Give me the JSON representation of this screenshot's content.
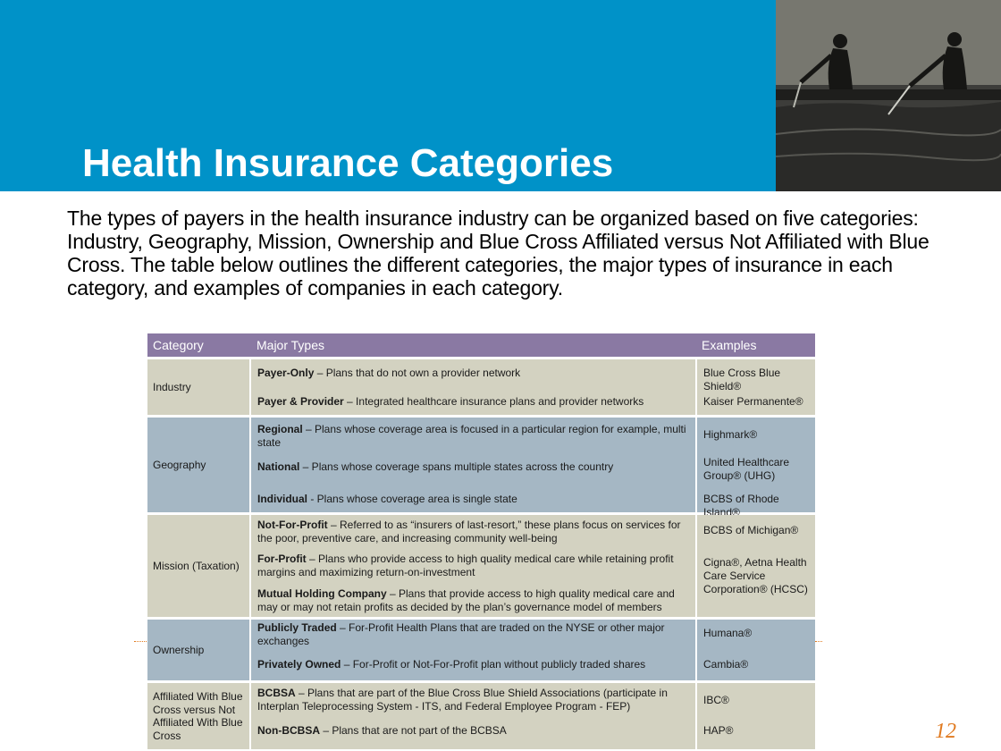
{
  "title": "Health Insurance Categories",
  "intro": "The types of payers in the health insurance industry can be organized based on five categories: Industry, Geography, Mission, Ownership and Blue Cross Affiliated versus Not Affiliated with Blue Cross. The table below outlines the different categories, the major types of insurance in each category, and examples of companies in each category.",
  "table": {
    "headers": [
      "Category",
      "Major Types",
      "Examples"
    ],
    "groups": [
      {
        "category": "Industry",
        "types": [
          {
            "label": "Payer-Only",
            "desc": " – Plans that do not own a provider network"
          },
          {
            "label": "Payer & Provider",
            "desc": " – Integrated healthcare insurance plans and provider networks"
          }
        ],
        "examples": [
          "Blue Cross Blue Shield®",
          "Kaiser Permanente®"
        ]
      },
      {
        "category": "Geography",
        "types": [
          {
            "label": "Regional",
            "desc": " – Plans whose coverage area is focused in a particular region for example, multi state"
          },
          {
            "label": "National",
            "desc": " – Plans whose coverage spans multiple states across the country"
          },
          {
            "label": "Individual",
            "desc": "  - Plans whose coverage area is single state"
          }
        ],
        "examples": [
          "Highmark®",
          "United Healthcare Group® (UHG)",
          "BCBS of Rhode Island®"
        ]
      },
      {
        "category": "Mission (Taxation)",
        "types": [
          {
            "label": "Not-For-Profit",
            "desc": " – Referred to as “insurers of last-resort,” these plans focus on services for the poor, preventive care, and increasing community well-being"
          },
          {
            "label": "For-Profit",
            "desc": " – Plans who provide access to high quality medical care while retaining profit margins and maximizing return-on-investment"
          },
          {
            "label": "Mutual Holding Company",
            "desc": " – Plans that provide access to high quality medical care and may or may not retain profits as decided by the plan’s governance model of members"
          }
        ],
        "examples": [
          "BCBS of Michigan®",
          "Cigna®, Aetna Health Care Service Corporation® (HCSC)"
        ]
      },
      {
        "category": "Ownership",
        "types": [
          {
            "label": "Publicly Traded",
            "desc": " – For-Profit Health Plans that are traded on the NYSE or other major exchanges"
          },
          {
            "label": "Privately Owned",
            "desc": " – For-Profit or Not-For-Profit plan without publicly traded shares"
          }
        ],
        "examples": [
          "Humana®",
          "Cambia®"
        ]
      },
      {
        "category": "Affiliated With Blue Cross versus Not Affiliated With Blue Cross",
        "types": [
          {
            "label": "BCBSA",
            "desc": " – Plans that are part of the Blue Cross Blue Shield Associations (participate in Interplan Teleprocessing System - ITS, and Federal Employee Program - FEP)"
          },
          {
            "label": "Non-BCBSA",
            "desc": " – Plans that are not part of the BCBSA"
          }
        ],
        "examples": [
          "IBC®",
          "HAP®"
        ]
      }
    ]
  },
  "page_number": "12",
  "colors": {
    "header_blue": "#0092c8",
    "table_header": "#8a79a3",
    "row_tan": "#d3d2c1",
    "row_blue": "#a5b7c4",
    "page_number": "#e07a20"
  }
}
